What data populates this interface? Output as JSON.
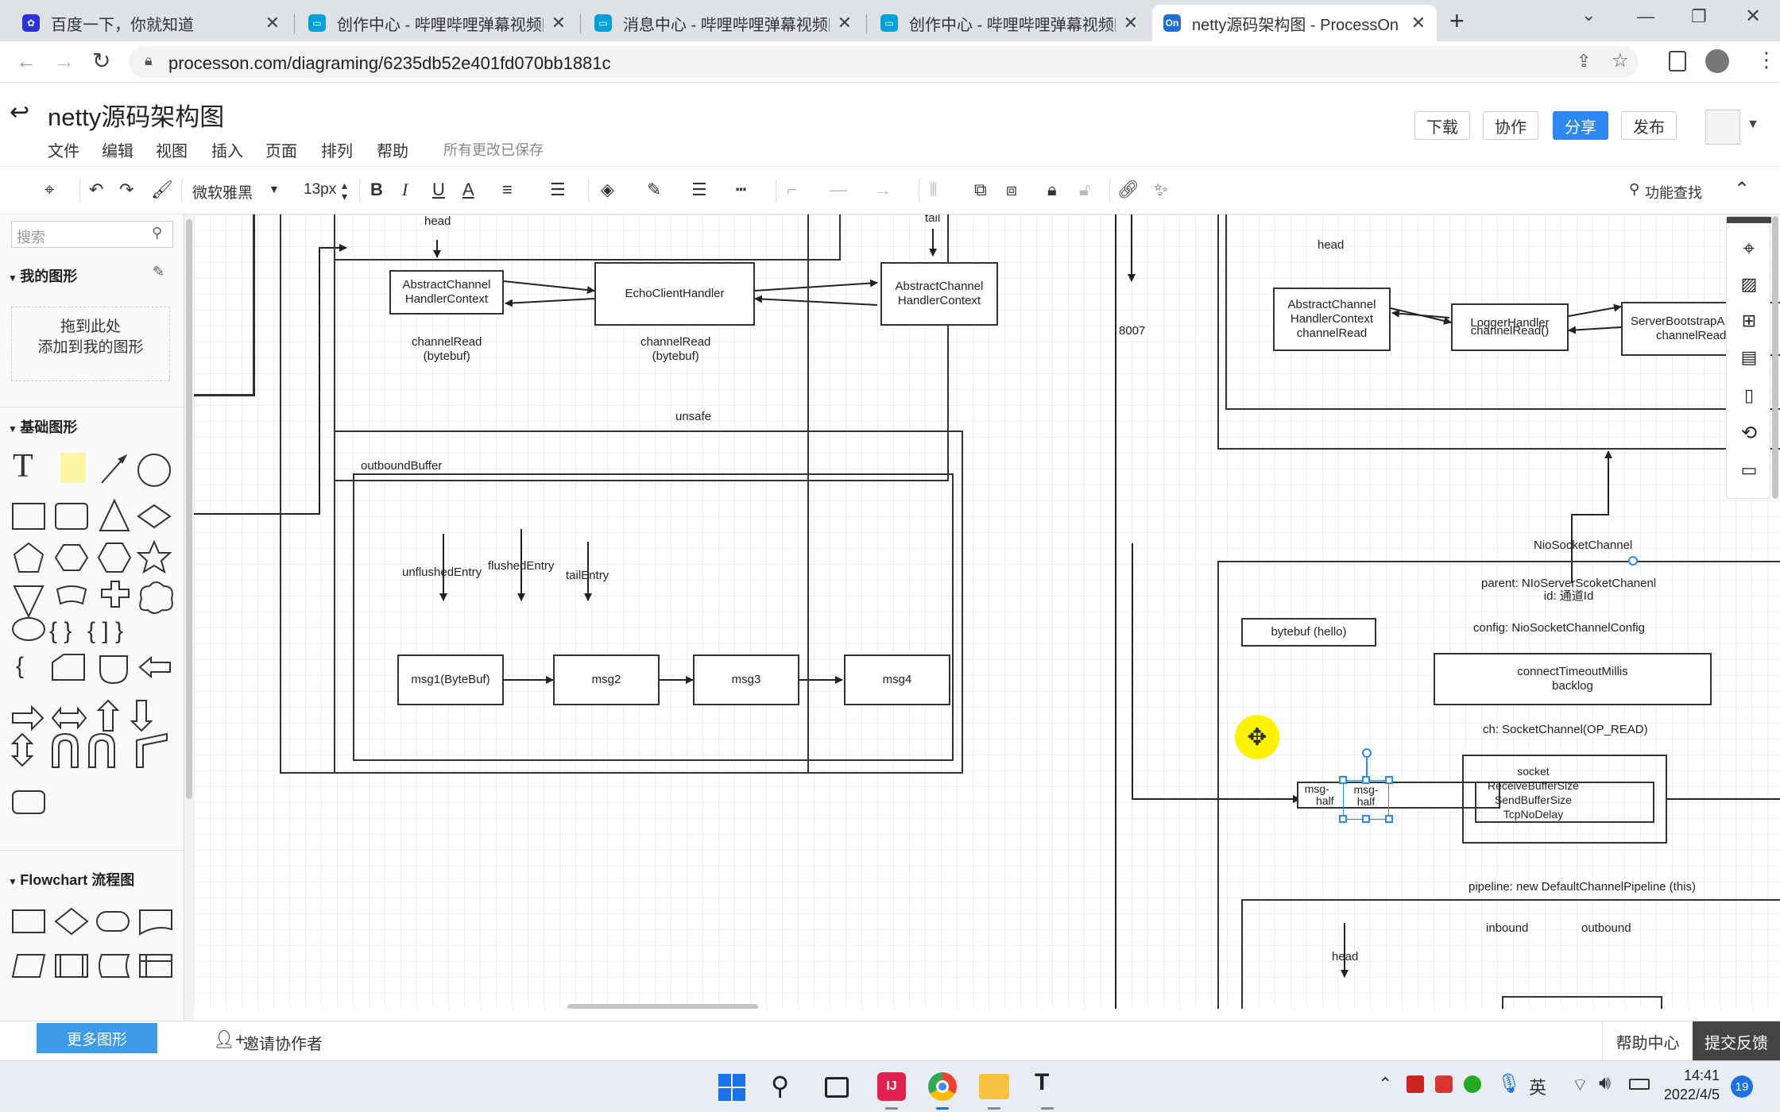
{
  "browser": {
    "tabs": [
      {
        "title": "百度一下，你就知道",
        "favicon": "baidu-paw-icon"
      },
      {
        "title": "创作中心 - 哔哩哔哩弹幕视频网",
        "favicon": "bilibili-tv-icon"
      },
      {
        "title": "消息中心 - 哔哩哔哩弹幕视频网",
        "favicon": "bilibili-tv-icon"
      },
      {
        "title": "创作中心 - 哔哩哔哩弹幕视频网",
        "favicon": "bilibili-tv-icon"
      },
      {
        "title": "netty源码架构图 - ProcessOn",
        "favicon": "On"
      }
    ],
    "new_tab": "+",
    "url": "processon.com/diagraming/6235db52e401fd070bb1881c"
  },
  "app": {
    "title": "netty源码架构图",
    "menus": [
      "文件",
      "编辑",
      "视图",
      "插入",
      "页面",
      "排列",
      "帮助"
    ],
    "save_status": "所有更改已保存",
    "buttons": {
      "download": "下载",
      "collab": "协作",
      "share": "分享",
      "publish": "发布"
    },
    "accent": "#2b88f5"
  },
  "toolbar": {
    "font": "微软雅黑",
    "size": "13px",
    "bold": "B",
    "italic": "I",
    "underline": "U",
    "font_color": "A",
    "search": "功能查找"
  },
  "left_panel": {
    "search_placeholder": "搜索",
    "my_shapes": "我的图形",
    "drop_hint_1": "拖到此处",
    "drop_hint_2": "添加到我的图形",
    "basic_shapes": "基础图形",
    "flowchart": "Flowchart 流程图",
    "more_shapes": "更多图形"
  },
  "diagram": {
    "head_left": "head",
    "tail_left": "tail",
    "ctx_left": [
      "AbstractChannel",
      "HandlerContext"
    ],
    "echo": "EchoClientHandler",
    "ctx_right": [
      "AbstractChannel",
      "HandlerContext"
    ],
    "channel_read_1": [
      "channelRead",
      "(bytebuf)"
    ],
    "channel_read_2": [
      "channelRead",
      "(bytebuf)"
    ],
    "unsafe": "unsafe",
    "outbound_buffer": "outboundBuffer",
    "unflushed": "unflushedEntry",
    "flushed": "flushedEntry",
    "tail_entry": "tailEntry",
    "msg1": "msg1(ByteBuf)",
    "msg2": "msg2",
    "msg3": "msg3",
    "msg4": "msg4",
    "port": "8007",
    "head_right": "head",
    "ctx_server": [
      "AbstractChannel",
      "HandlerContext",
      "channelRead"
    ],
    "logger": [
      "LoggerHandler",
      "channelRead()"
    ],
    "server_bootstrap": [
      "ServerBootstrapA",
      "channelRead"
    ],
    "nio_socket_channel": "NioSocketChannel",
    "parent": [
      "parent: NIoServerScoketChanenl",
      "id: 通道Id"
    ],
    "bytebuf_hello": "bytebuf  (hello)",
    "config": "config: NioSocketChannelConfig",
    "connect": [
      "connectTimeoutMillis",
      "backlog"
    ],
    "ch": "ch: SocketChannel(OP_READ)",
    "msg_half_1": [
      "msg-",
      "half"
    ],
    "msg_half_2": [
      "msg-",
      "half"
    ],
    "socket": [
      "socket",
      "ReceiveBufferSize",
      "SendBufferSize",
      "TcpNoDelay"
    ],
    "pipeline": "pipeline:  new DefaultChannelPipeline  (this)",
    "inbound": "inbound",
    "outbound": "outbound",
    "head_bottom": "head"
  },
  "bottom": {
    "invite": "邀请协作者",
    "help": "帮助中心",
    "feedback": "提交反馈"
  },
  "taskbar": {
    "time": "14:41",
    "date": "2022/4/5",
    "ime": "英",
    "notifications": "19"
  }
}
